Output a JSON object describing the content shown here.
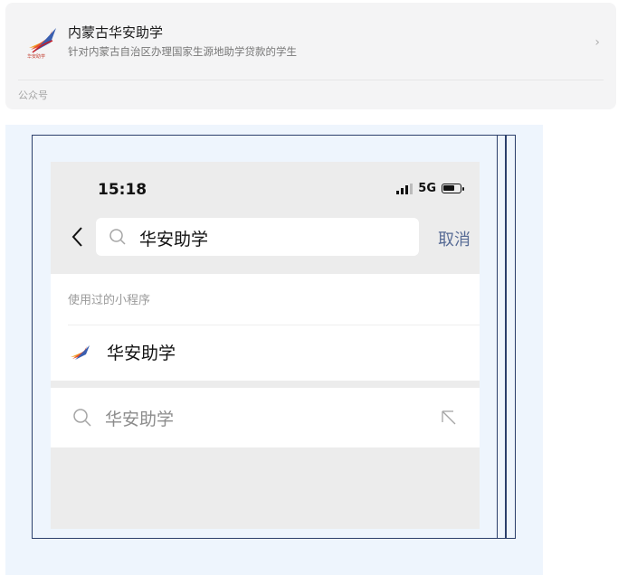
{
  "official_account": {
    "name": "内蒙古华安助学",
    "description": "针对内蒙古自治区办理国家生源地助学贷款的学生",
    "kind": "公众号",
    "logo_text": "华安助学"
  },
  "phone": {
    "status_bar": {
      "time": "15:18",
      "network": "5G"
    },
    "search": {
      "query": "华安助学",
      "cancel_label": "取消"
    },
    "used_section_title": "使用过的小程序",
    "used_items": [
      {
        "name": "华安助学"
      }
    ],
    "suggestions": [
      {
        "text": "华安助学"
      }
    ]
  },
  "colors": {
    "link": "#576b95",
    "frame_bg": "#eef5fd",
    "frame_line": "#2b3f6b"
  }
}
